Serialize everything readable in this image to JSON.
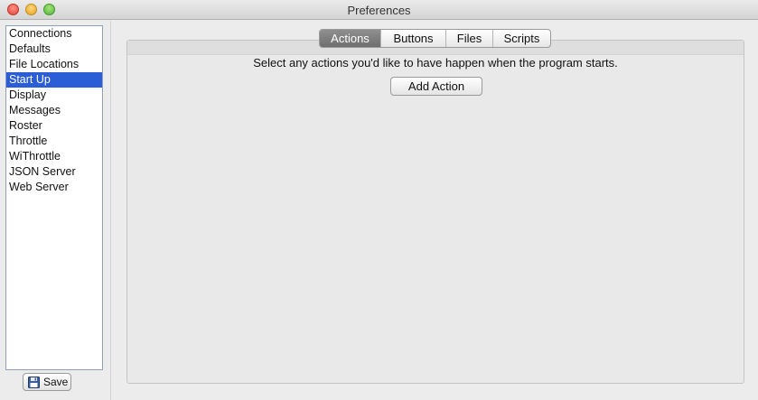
{
  "window": {
    "title": "Preferences"
  },
  "sidebar": {
    "items": [
      {
        "label": "Connections"
      },
      {
        "label": "Defaults"
      },
      {
        "label": "File Locations"
      },
      {
        "label": "Start Up",
        "selected": true
      },
      {
        "label": "Display"
      },
      {
        "label": "Messages"
      },
      {
        "label": "Roster"
      },
      {
        "label": "Throttle"
      },
      {
        "label": "WiThrottle"
      },
      {
        "label": "JSON Server"
      },
      {
        "label": "Web Server"
      }
    ],
    "save_label": "Save",
    "save_icon": "floppy-disk-icon"
  },
  "tabs": [
    {
      "label": "Actions",
      "active": true
    },
    {
      "label": "Buttons"
    },
    {
      "label": "Files"
    },
    {
      "label": "Scripts"
    }
  ],
  "main": {
    "instruction": "Select any actions you'd like to have happen when the program starts.",
    "add_action_label": "Add Action"
  },
  "colors": {
    "selection": "#2a5dd6",
    "active_tab": "#7a7a7a"
  }
}
